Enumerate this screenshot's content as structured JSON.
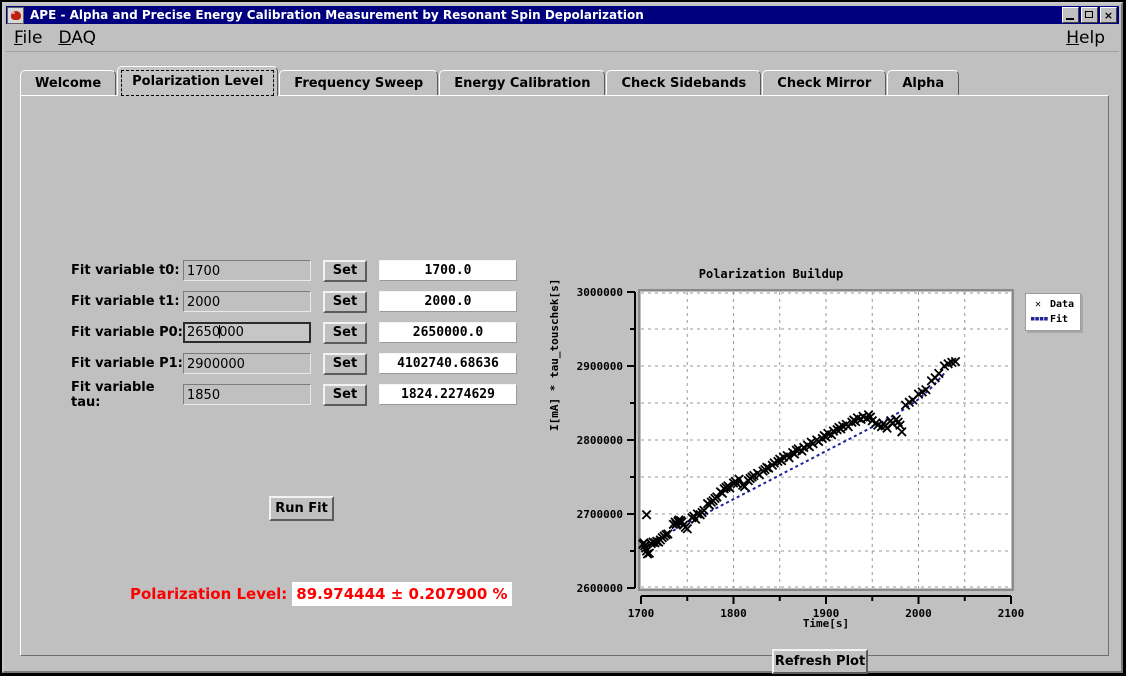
{
  "window": {
    "title": "APE - Alpha and Precise Energy Calibration Measurement by Resonant Spin Depolarization",
    "icon": "app-icon",
    "buttons": {
      "minimize": "_",
      "maximize": "□",
      "close": "×"
    }
  },
  "menubar": {
    "items": [
      {
        "label": "File",
        "mnemonic": "F"
      },
      {
        "label": "DAQ",
        "mnemonic": "D"
      }
    ],
    "help": {
      "label": "Help",
      "mnemonic": "H"
    }
  },
  "tabs": [
    {
      "label": "Welcome",
      "selected": false
    },
    {
      "label": "Polarization Level",
      "selected": true
    },
    {
      "label": "Frequency Sweep",
      "selected": false
    },
    {
      "label": "Energy Calibration",
      "selected": false
    },
    {
      "label": "Check Sidebands",
      "selected": false
    },
    {
      "label": "Check Mirror",
      "selected": false
    },
    {
      "label": "Alpha",
      "selected": false
    }
  ],
  "form": {
    "set_label": "Set",
    "rows": [
      {
        "label": "Fit variable t0:",
        "input": "1700",
        "output": "1700.0",
        "focused": false
      },
      {
        "label": "Fit variable t1:",
        "input": "2000",
        "output": "2000.0",
        "focused": false
      },
      {
        "label": "Fit variable P0:",
        "input": "2650000",
        "output": "2650000.0",
        "focused": true,
        "caret_after": 4
      },
      {
        "label": "Fit variable P1:",
        "input": "2900000",
        "output": "4102740.68636",
        "focused": false
      },
      {
        "label": "Fit variable tau:",
        "input": "1850",
        "output": "1824.2274629",
        "focused": false
      }
    ]
  },
  "buttons": {
    "run_fit": "Run Fit",
    "refresh_plot": "Refresh Plot"
  },
  "result": {
    "label": "Polarization Level:",
    "value": "89.974444 ± 0.207900 %",
    "color": "#fe0000"
  },
  "chart_data": {
    "type": "scatter",
    "title": "Polarization Buildup",
    "xlabel": "Time[s]",
    "ylabel": "I[mA] * tau_touschek[s]",
    "xlim": [
      1700,
      2100
    ],
    "ylim": [
      2600000,
      3000000
    ],
    "xticks": [
      1700,
      1800,
      1900,
      2000,
      2100
    ],
    "xticks_minor": [
      1750,
      1850,
      1950,
      2050
    ],
    "yticks": [
      2600000,
      2700000,
      2800000,
      2900000,
      3000000
    ],
    "yticks_minor": [
      2650000,
      2750000,
      2850000,
      2950000
    ],
    "grid": true,
    "legend": [
      {
        "name": "Data",
        "marker": "x",
        "color": "#000000"
      },
      {
        "name": "Fit",
        "marker": "dashed-line",
        "color": "#20209a"
      }
    ],
    "series": [
      {
        "name": "Data",
        "marker": "x",
        "color": "#000000",
        "points": [
          [
            1702,
            2659000
          ],
          [
            1703,
            2661000
          ],
          [
            1704,
            2657000
          ],
          [
            1705,
            2654000
          ],
          [
            1706,
            2650000
          ],
          [
            1707,
            2646000
          ],
          [
            1709,
            2647000
          ],
          [
            1711,
            2660000
          ],
          [
            1713,
            2662000
          ],
          [
            1715,
            2661000
          ],
          [
            1717,
            2663000
          ],
          [
            1719,
            2662000
          ],
          [
            1721,
            2665000
          ],
          [
            1723,
            2668000
          ],
          [
            1725,
            2670000
          ],
          [
            1727,
            2672000
          ],
          [
            1729,
            2673000
          ],
          [
            1706,
            2699000
          ],
          [
            1735,
            2686000
          ],
          [
            1737,
            2689000
          ],
          [
            1738,
            2686000
          ],
          [
            1740,
            2690000
          ],
          [
            1741,
            2692000
          ],
          [
            1743,
            2691000
          ],
          [
            1744,
            2689000
          ],
          [
            1746,
            2685000
          ],
          [
            1748,
            2682000
          ],
          [
            1750,
            2680000
          ],
          [
            1755,
            2695000
          ],
          [
            1757,
            2697000
          ],
          [
            1759,
            2693000
          ],
          [
            1761,
            2700000
          ],
          [
            1764,
            2699000
          ],
          [
            1766,
            2702000
          ],
          [
            1768,
            2705000
          ],
          [
            1772,
            2714000
          ],
          [
            1774,
            2712000
          ],
          [
            1776,
            2716000
          ],
          [
            1778,
            2718000
          ],
          [
            1780,
            2721000
          ],
          [
            1782,
            2723000
          ],
          [
            1786,
            2730000
          ],
          [
            1788,
            2728000
          ],
          [
            1790,
            2734000
          ],
          [
            1792,
            2736000
          ],
          [
            1794,
            2738000
          ],
          [
            1796,
            2735000
          ],
          [
            1800,
            2742000
          ],
          [
            1802,
            2744000
          ],
          [
            1804,
            2741000
          ],
          [
            1806,
            2747000
          ],
          [
            1810,
            2739000
          ],
          [
            1812,
            2737000
          ],
          [
            1816,
            2745000
          ],
          [
            1818,
            2748000
          ],
          [
            1820,
            2750000
          ],
          [
            1822,
            2752000
          ],
          [
            1826,
            2755000
          ],
          [
            1828,
            2753000
          ],
          [
            1832,
            2758000
          ],
          [
            1834,
            2760000
          ],
          [
            1836,
            2763000
          ],
          [
            1838,
            2762000
          ],
          [
            1842,
            2766000
          ],
          [
            1844,
            2769000
          ],
          [
            1848,
            2771000
          ],
          [
            1850,
            2774000
          ],
          [
            1852,
            2772000
          ],
          [
            1854,
            2777000
          ],
          [
            1858,
            2779000
          ],
          [
            1860,
            2776000
          ],
          [
            1864,
            2783000
          ],
          [
            1866,
            2781000
          ],
          [
            1868,
            2786000
          ],
          [
            1870,
            2788000
          ],
          [
            1874,
            2785000
          ],
          [
            1876,
            2790000
          ],
          [
            1880,
            2793000
          ],
          [
            1882,
            2791000
          ],
          [
            1884,
            2797000
          ],
          [
            1886,
            2795000
          ],
          [
            1890,
            2800000
          ],
          [
            1892,
            2798000
          ],
          [
            1896,
            2802000
          ],
          [
            1898,
            2806000
          ],
          [
            1900,
            2804000
          ],
          [
            1902,
            2809000
          ],
          [
            1906,
            2807000
          ],
          [
            1908,
            2812000
          ],
          [
            1912,
            2814000
          ],
          [
            1914,
            2817000
          ],
          [
            1916,
            2815000
          ],
          [
            1918,
            2819000
          ],
          [
            1922,
            2821000
          ],
          [
            1924,
            2818000
          ],
          [
            1928,
            2824000
          ],
          [
            1930,
            2827000
          ],
          [
            1932,
            2825000
          ],
          [
            1934,
            2830000
          ],
          [
            1938,
            2828000
          ],
          [
            1940,
            2832000
          ],
          [
            1944,
            2829000
          ],
          [
            1946,
            2834000
          ],
          [
            1948,
            2831000
          ],
          [
            1950,
            2826000
          ],
          [
            1954,
            2823000
          ],
          [
            1956,
            2820000
          ],
          [
            1960,
            2818000
          ],
          [
            1962,
            2822000
          ],
          [
            1964,
            2819000
          ],
          [
            1966,
            2816000
          ],
          [
            1970,
            2826000
          ],
          [
            1972,
            2822000
          ],
          [
            1976,
            2828000
          ],
          [
            1978,
            2824000
          ],
          [
            1980,
            2820000
          ],
          [
            1982,
            2811000
          ],
          [
            1986,
            2847000
          ],
          [
            1990,
            2851000
          ],
          [
            1994,
            2854000
          ],
          [
            2000,
            2862000
          ],
          [
            2004,
            2865000
          ],
          [
            2008,
            2868000
          ],
          [
            2014,
            2880000
          ],
          [
            2018,
            2884000
          ],
          [
            2022,
            2890000
          ],
          [
            2028,
            2900000
          ],
          [
            2032,
            2903000
          ],
          [
            2036,
            2905000
          ],
          [
            2040,
            2906000
          ]
        ]
      },
      {
        "name": "Fit",
        "marker": "dashed-line",
        "color": "#20209a",
        "points": [
          [
            1700,
            2655000
          ],
          [
            1720,
            2668000
          ],
          [
            1740,
            2681000
          ],
          [
            1760,
            2694000
          ],
          [
            1780,
            2707000
          ],
          [
            1800,
            2720000
          ],
          [
            1820,
            2733000
          ],
          [
            1840,
            2746000
          ],
          [
            1860,
            2759000
          ],
          [
            1880,
            2772000
          ],
          [
            1900,
            2785000
          ],
          [
            1920,
            2798000
          ],
          [
            1940,
            2811000
          ],
          [
            1960,
            2824000
          ],
          [
            1980,
            2838000
          ],
          [
            2000,
            2855000
          ],
          [
            2015,
            2872000
          ],
          [
            2030,
            2893000
          ]
        ]
      }
    ]
  }
}
